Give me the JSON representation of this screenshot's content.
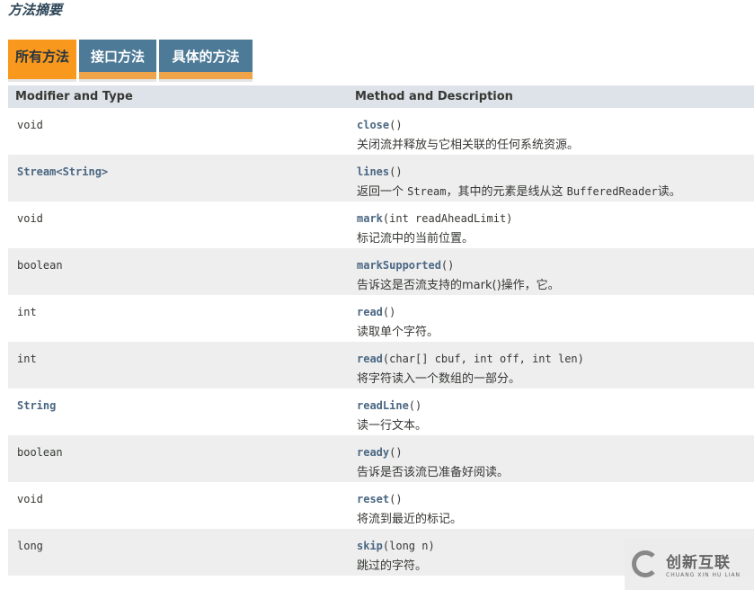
{
  "section_title": "方法摘要",
  "tabs": [
    {
      "label": "所有方法",
      "active": true
    },
    {
      "label": "接口方法",
      "active": false
    },
    {
      "label": "具体的方法",
      "active": false
    }
  ],
  "table": {
    "headers": [
      "Modifier and Type",
      "Method and Description"
    ],
    "rows": [
      {
        "type": "void",
        "method": "close",
        "params": "()",
        "desc": "关闭流并释放与它相关联的任何系统资源。"
      },
      {
        "type": "Stream<String>",
        "method": "lines",
        "params": "()",
        "desc_pre": "返回一个 ",
        "desc_code1": "Stream",
        "desc_mid": "，其中的元素是线从这 ",
        "desc_code2": "BufferedReader",
        "desc_post": "读。"
      },
      {
        "type": "void",
        "method": "mark",
        "params": "(int readAheadLimit)",
        "desc": "标记流中的当前位置。"
      },
      {
        "type": "boolean",
        "method": "markSupported",
        "params": "()",
        "desc": "告诉这是否流支持的mark()操作，它。"
      },
      {
        "type": "int",
        "method": "read",
        "params": "()",
        "desc": "读取单个字符。"
      },
      {
        "type": "int",
        "method": "read",
        "params": "(char[] cbuf, int off, int len)",
        "desc": "将字符读入一个数组的一部分。"
      },
      {
        "type": "String",
        "method": "readLine",
        "params": "()",
        "desc": "读一行文本。"
      },
      {
        "type": "boolean",
        "method": "ready",
        "params": "()",
        "desc": "告诉是否该流已准备好阅读。"
      },
      {
        "type": "void",
        "method": "reset",
        "params": "()",
        "desc": "将流到最近的标记。"
      },
      {
        "type": "long",
        "method": "skip",
        "params": "(long n)",
        "desc": "跳过的字符。"
      }
    ]
  },
  "watermark": {
    "cn": "创新互联",
    "en": "CHUANG XIN HU LIAN"
  }
}
